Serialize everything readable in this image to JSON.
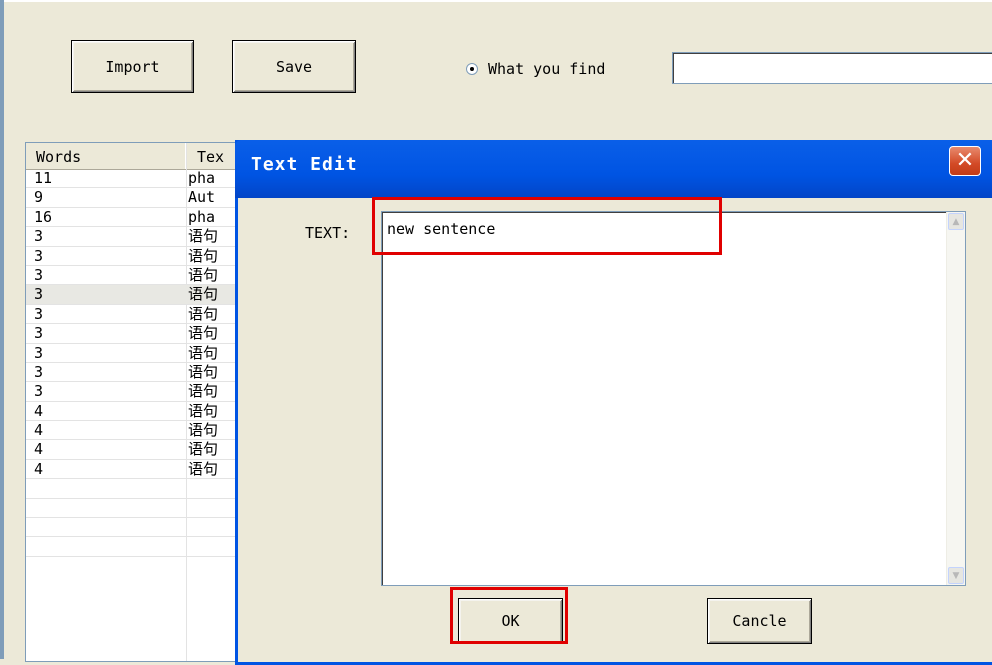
{
  "toolbar": {
    "import_label": "Import",
    "save_label": "Save",
    "find_option_label": "What you find",
    "find_value": ""
  },
  "list": {
    "columns": [
      "Words",
      "Tex"
    ],
    "rows": [
      {
        "words": "11",
        "text": "pha"
      },
      {
        "words": "9",
        "text": "Aut"
      },
      {
        "words": "16",
        "text": "pha"
      },
      {
        "words": "3",
        "text": "语句"
      },
      {
        "words": "3",
        "text": "语句"
      },
      {
        "words": "3",
        "text": "语句"
      },
      {
        "words": "3",
        "text": "语句",
        "selected": true
      },
      {
        "words": "3",
        "text": "语句"
      },
      {
        "words": "3",
        "text": "语句"
      },
      {
        "words": "3",
        "text": "语句"
      },
      {
        "words": "3",
        "text": "语句"
      },
      {
        "words": "3",
        "text": "语句"
      },
      {
        "words": "4",
        "text": "语句"
      },
      {
        "words": "4",
        "text": "语句"
      },
      {
        "words": "4",
        "text": "语句"
      },
      {
        "words": "4",
        "text": "语句"
      },
      {
        "words": "",
        "text": ""
      },
      {
        "words": "",
        "text": ""
      },
      {
        "words": "",
        "text": ""
      },
      {
        "words": "",
        "text": ""
      }
    ]
  },
  "dialog": {
    "title": "Text Edit",
    "close_glyph": "✕",
    "text_label": "TEXT:",
    "text_value": "new sentence",
    "ok_label": "OK",
    "cancel_label": "Cancle"
  },
  "icons": {
    "scroll_up": "▲",
    "scroll_down": "▼"
  },
  "colors": {
    "titlebar": "#0054e3",
    "highlight": "#e00000",
    "window_bg": "#ece9d8"
  }
}
